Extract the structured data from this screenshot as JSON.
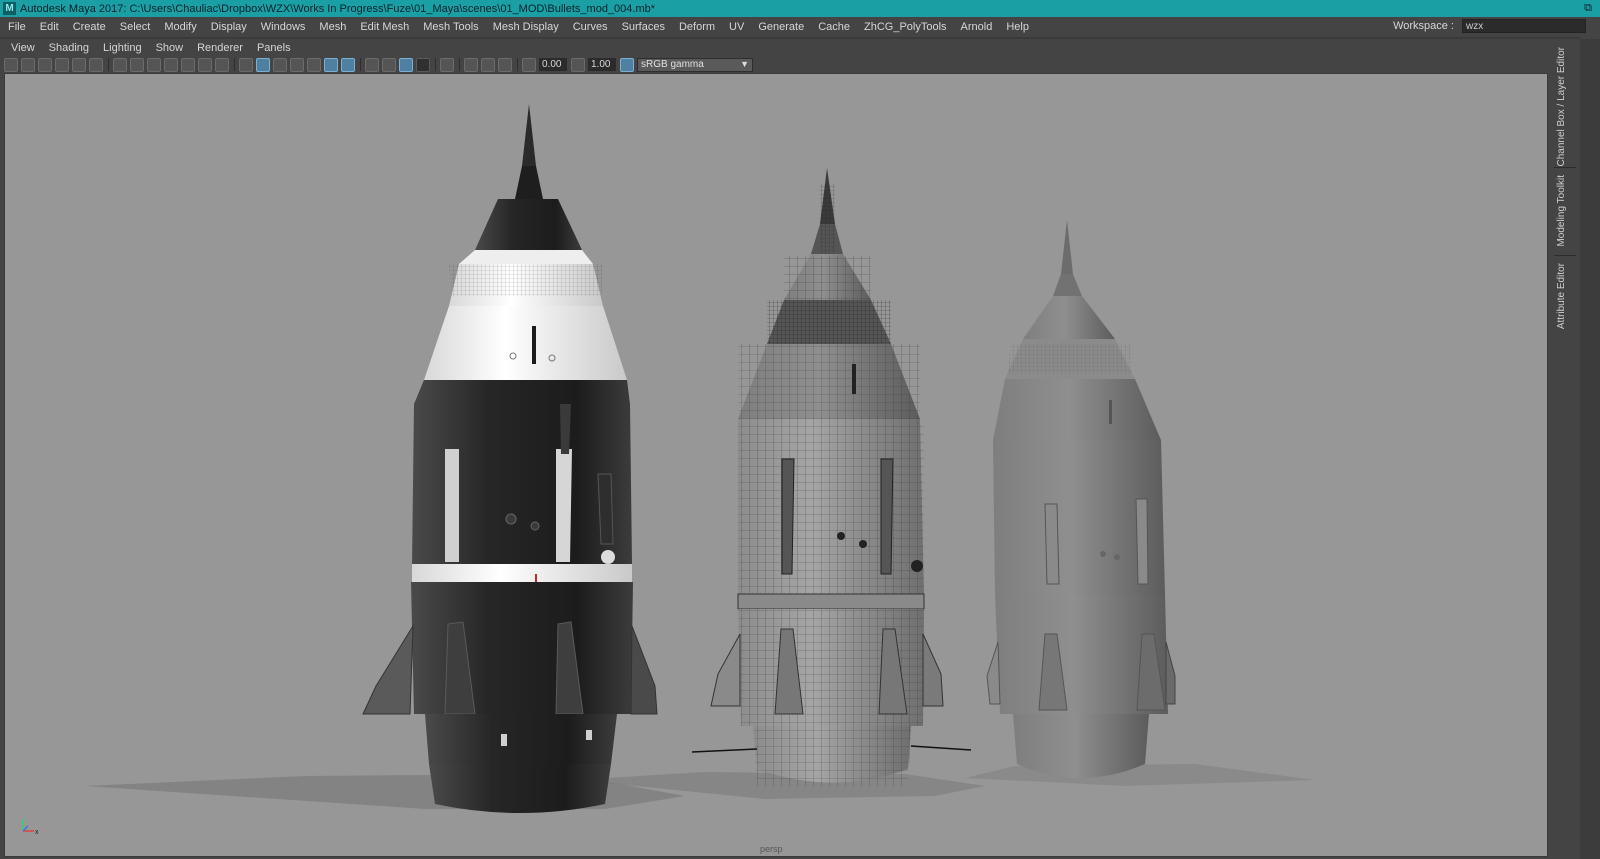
{
  "window": {
    "title": "Autodesk Maya 2017: C:\\Users\\Chauliac\\Dropbox\\WZX\\Works In Progress\\Fuze\\01_Maya\\scenes\\01_MOD\\Bullets_mod_004.mb*",
    "app_icon": "M"
  },
  "menubar": {
    "items": [
      "File",
      "Edit",
      "Create",
      "Select",
      "Modify",
      "Display",
      "Windows",
      "Mesh",
      "Edit Mesh",
      "Mesh Tools",
      "Mesh Display",
      "Curves",
      "Surfaces",
      "Deform",
      "UV",
      "Generate",
      "Cache",
      "ZhCG_PolyTools",
      "Arnold",
      "Help"
    ],
    "workspace_label": "Workspace :",
    "workspace_value": "wzx"
  },
  "panel_menu": {
    "items": [
      "View",
      "Shading",
      "Lighting",
      "Show",
      "Renderer",
      "Panels"
    ]
  },
  "toolbar": {
    "exposure": "0.00",
    "gamma": "1.00",
    "color_space": "sRGB gamma"
  },
  "viewport": {
    "camera": "persp"
  },
  "side_tabs": [
    "Channel Box / Layer Editor",
    "Modeling Toolkit",
    "Attribute Editor"
  ],
  "colors": {
    "titlebar": "#1aa0a4",
    "viewport": "#979797",
    "ui_bg": "#444444",
    "highlight": "#4f7fa1"
  }
}
